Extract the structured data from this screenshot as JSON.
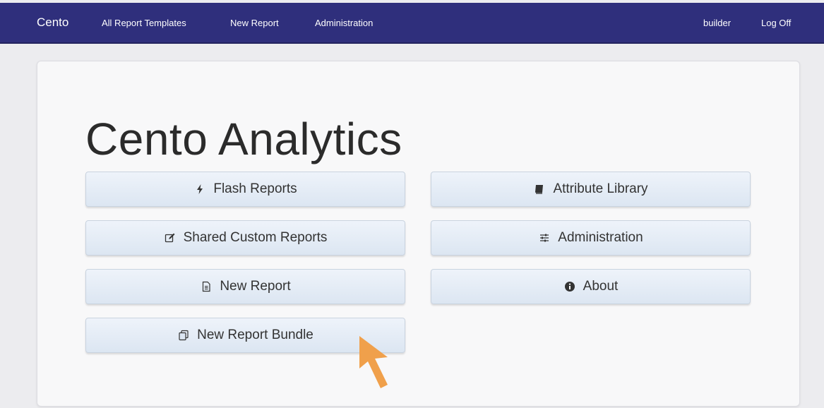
{
  "navbar": {
    "brand": "Cento",
    "links": [
      "All Report Templates",
      "New Report",
      "Administration"
    ],
    "user": "builder",
    "logoff": "Log Off",
    "bg_color": "#2f2f7c"
  },
  "main": {
    "title": "Cento Analytics",
    "tiles": [
      {
        "label": "Flash Reports",
        "icon": "bolt-icon"
      },
      {
        "label": "Attribute Library",
        "icon": "book-icon"
      },
      {
        "label": "Shared Custom Reports",
        "icon": "edit-icon"
      },
      {
        "label": "Administration",
        "icon": "sliders-icon"
      },
      {
        "label": "New Report",
        "icon": "document-icon"
      },
      {
        "label": "About",
        "icon": "info-icon"
      },
      {
        "label": "New Report Bundle",
        "icon": "copy-icon"
      }
    ]
  },
  "colors": {
    "tile_top": "#eef3fa",
    "tile_bottom": "#dce6f2",
    "cursor": "#f0a04b"
  }
}
